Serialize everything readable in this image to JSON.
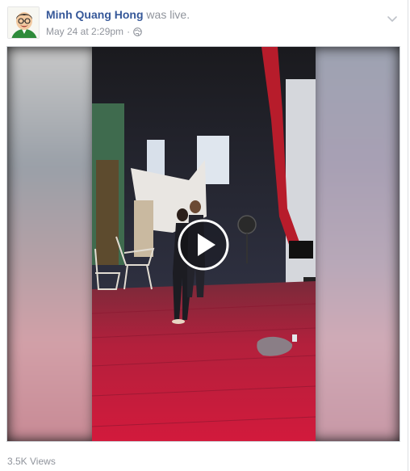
{
  "post": {
    "author": "Minh Quang Hong",
    "action": "was live.",
    "timestamp": "May 24 at 2:29pm",
    "separator": "·",
    "privacy_icon": "globe-icon",
    "menu_icon": "chevron-down-icon"
  },
  "video": {
    "play_icon": "play-icon",
    "state": "paused"
  },
  "stats": {
    "views": "3.5K Views"
  },
  "colors": {
    "author_link": "#365899",
    "secondary_text": "#90949c",
    "border": "#dddfe2"
  }
}
